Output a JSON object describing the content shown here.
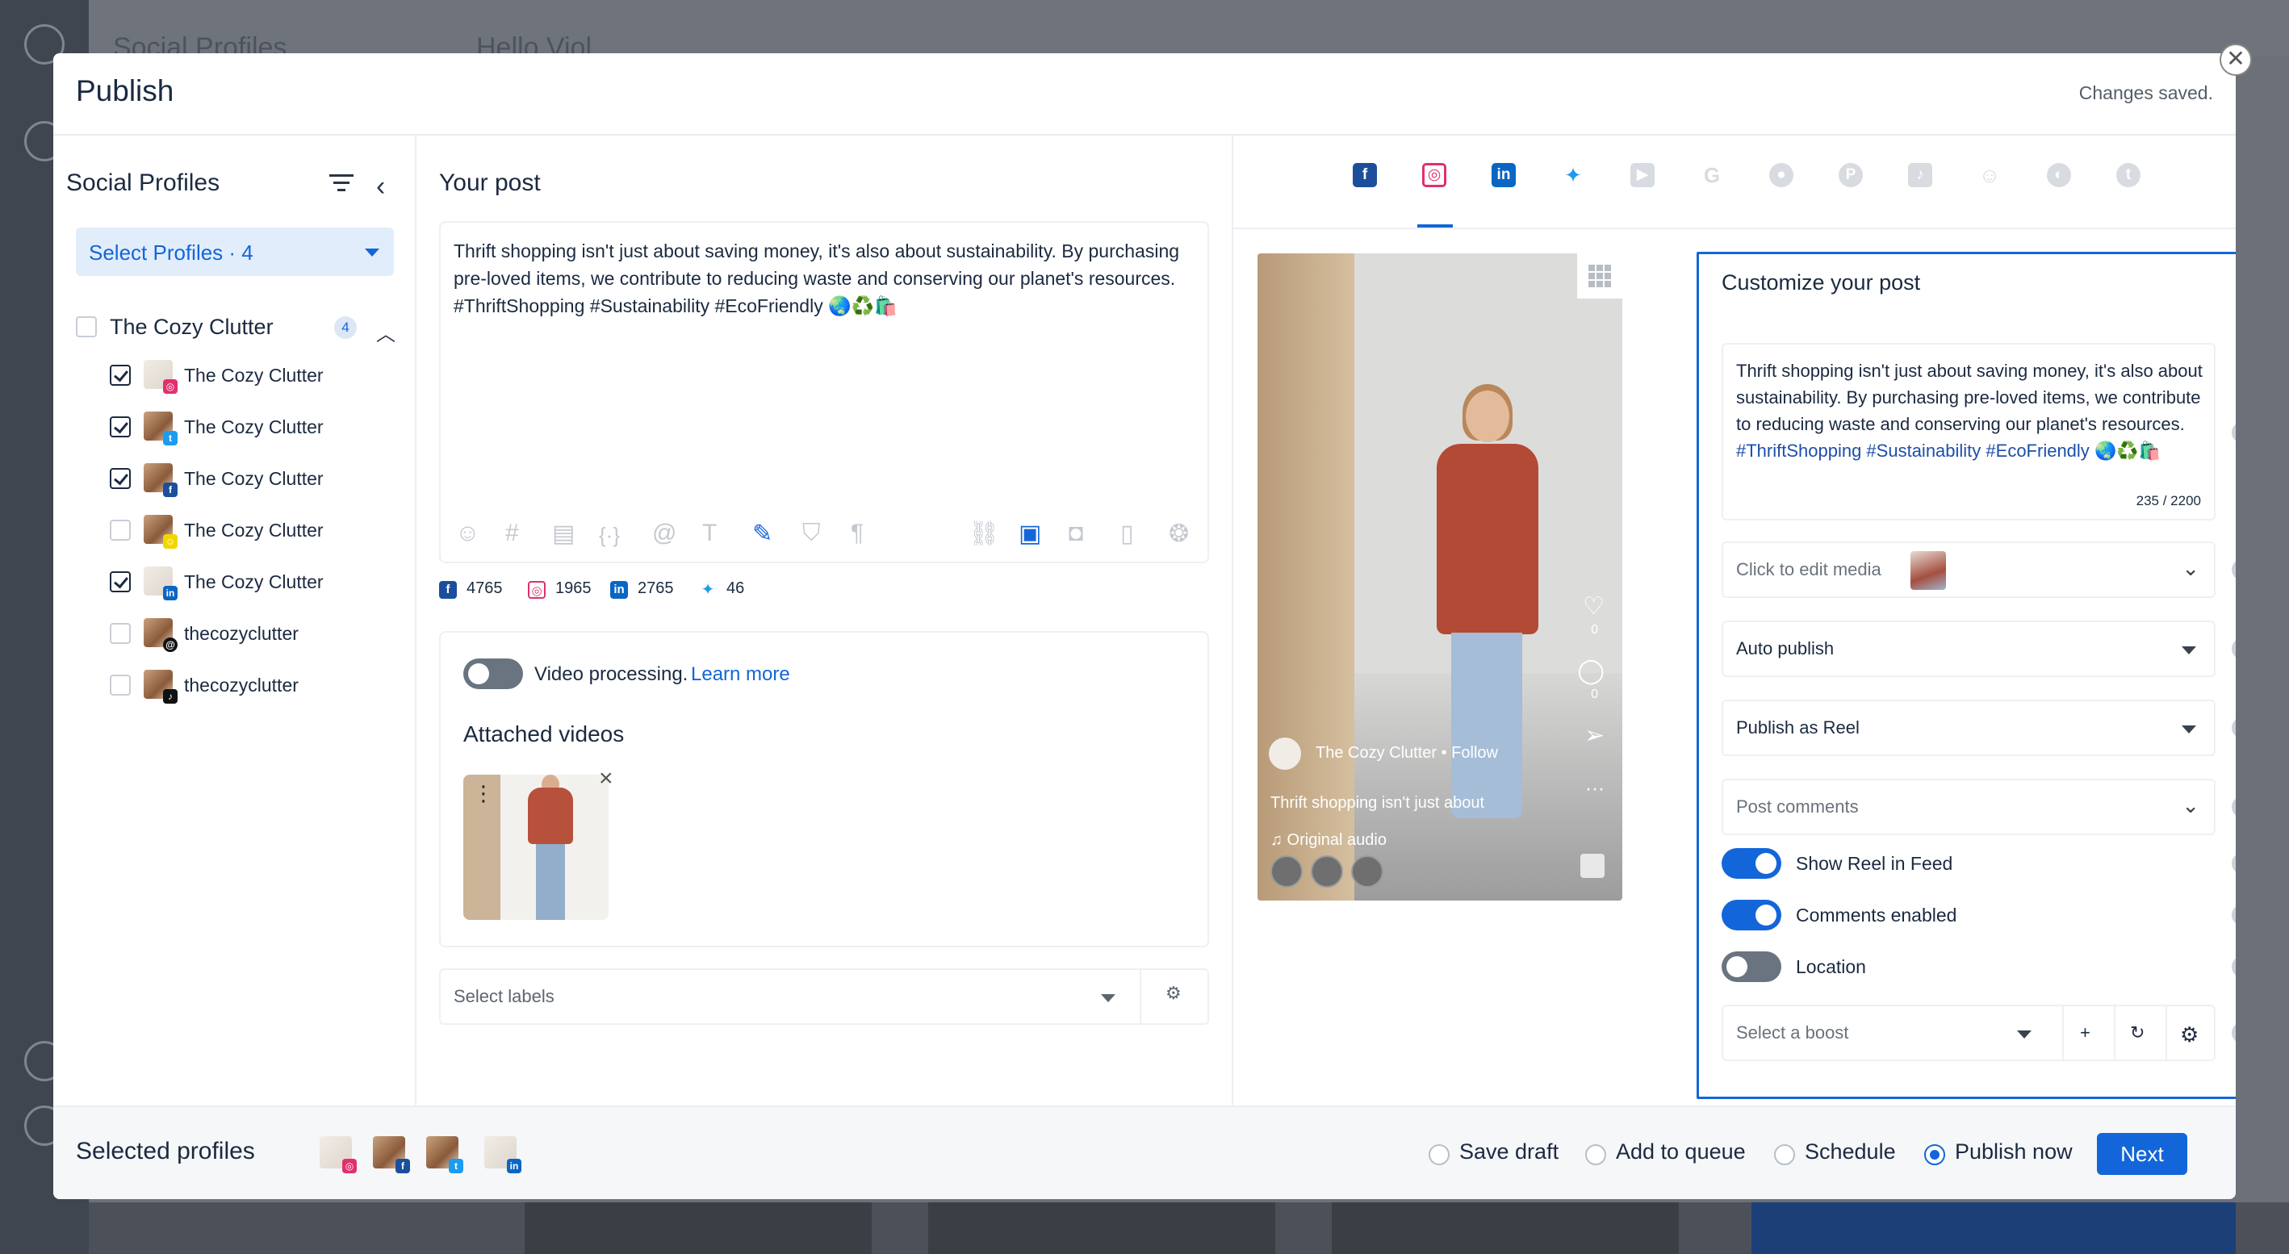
{
  "background": {
    "tab_title": "Social Profiles",
    "greeting": "Hello Viol"
  },
  "modal": {
    "title": "Publish",
    "status": "Changes saved.",
    "close_glyph": "✕"
  },
  "left": {
    "title": "Social Profiles",
    "select_label": "Select Profiles · 4",
    "group": {
      "name": "The Cozy Clutter",
      "count": "4"
    },
    "profiles": [
      {
        "name": "The Cozy Clutter",
        "network": "instagram",
        "checked": true
      },
      {
        "name": "The Cozy Clutter",
        "network": "twitter",
        "checked": true
      },
      {
        "name": "The Cozy Clutter",
        "network": "facebook",
        "checked": true
      },
      {
        "name": "The Cozy Clutter",
        "network": "snapchat",
        "checked": false
      },
      {
        "name": "The Cozy Clutter",
        "network": "linkedin",
        "checked": true
      },
      {
        "name": "thecozyclutter",
        "network": "threads",
        "checked": false
      },
      {
        "name": "thecozyclutter",
        "network": "tiktok",
        "checked": false
      }
    ]
  },
  "middle": {
    "title": "Your post",
    "post_text": "Thrift shopping isn't just about saving money, it's also about sustainability. By purchasing pre-loved items, we contribute to reducing waste and conserving our planet's resources. #ThriftShopping #Sustainability #EcoFriendly 🌏♻️🛍️",
    "counts": {
      "facebook": "4765",
      "instagram": "1965",
      "linkedin": "2765",
      "twitter": "46"
    },
    "video_processing": "Video processing.",
    "learn_more": "Learn more",
    "attached_title": "Attached videos",
    "labels_placeholder": "Select labels"
  },
  "right": {
    "networks": [
      "facebook",
      "instagram",
      "linkedin",
      "twitter",
      "youtube",
      "google",
      "reddit",
      "pinterest",
      "tiktok",
      "snapchat",
      "threads",
      "tumblr"
    ],
    "active_network": "instagram",
    "preview": {
      "username": "The Cozy Clutter • Follow",
      "caption": "Thrift shopping isn't just about",
      "audio": "♫ Original audio",
      "likes": "0",
      "comments": "0"
    },
    "customize": {
      "title": "Customize your post",
      "text_plain": "Thrift shopping isn't just about saving money, it's also about sustainability. By purchasing pre-loved items, we contribute to reducing waste and conserving our planet's resources.",
      "hashtags": "#ThriftShopping #Sustainability #EcoFriendly",
      "emoji": "🌏♻️🛍️",
      "char_count": "235 / 2200",
      "media_label": "Click to edit media",
      "auto_publish": "Auto publish",
      "publish_as": "Publish as Reel",
      "post_comments": "Post comments",
      "show_reel": "Show Reel in Feed",
      "comments_enabled": "Comments enabled",
      "location": "Location",
      "boost_placeholder": "Select a boost"
    }
  },
  "footer": {
    "selected_title": "Selected profiles",
    "options": [
      "Save draft",
      "Add to queue",
      "Schedule",
      "Publish now"
    ],
    "selected_option": "Publish now",
    "next": "Next"
  },
  "colors": {
    "accent": "#1366d9",
    "facebook": "#1b4f9c",
    "instagram": "#e1306c",
    "linkedin": "#0a66c2",
    "twitter": "#1d9bf0",
    "snapchat": "#f2d600",
    "tiktok": "#111111"
  }
}
